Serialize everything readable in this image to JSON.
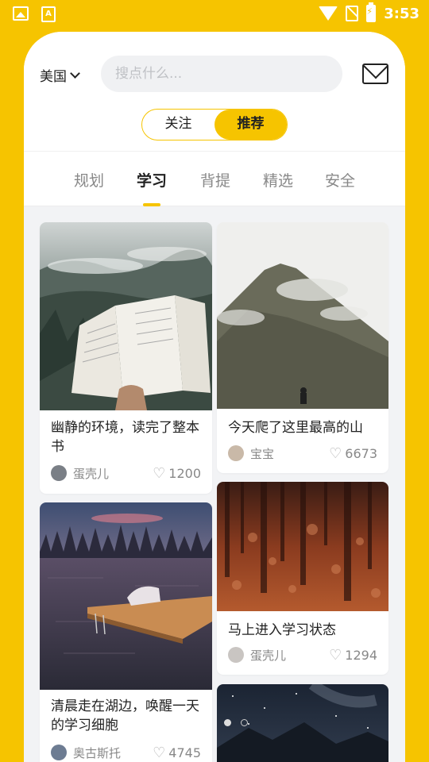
{
  "status_bar": {
    "time": "3:53"
  },
  "header": {
    "region": "美国",
    "search_placeholder": "搜点什么...",
    "toggle": {
      "follow": "关注",
      "recommend": "推荐"
    }
  },
  "tabs": [
    "规划",
    "学习",
    "背提",
    "精选",
    "安全"
  ],
  "active_tab": "学习",
  "posts": [
    {
      "title": "幽静的环境，读完了整本书",
      "author": "蛋壳儿",
      "likes": "1200"
    },
    {
      "title": "今天爬了这里最高的山",
      "author": "宝宝",
      "likes": "6673"
    },
    {
      "title": "清晨走在湖边，唤醒一天的学习细胞",
      "author": "奥古斯托",
      "likes": "4745"
    },
    {
      "title": "马上进入学习状态",
      "author": "蛋壳儿",
      "likes": "1294"
    }
  ],
  "colors": {
    "accent": "#F6C400",
    "background": "#F2F3F5"
  }
}
